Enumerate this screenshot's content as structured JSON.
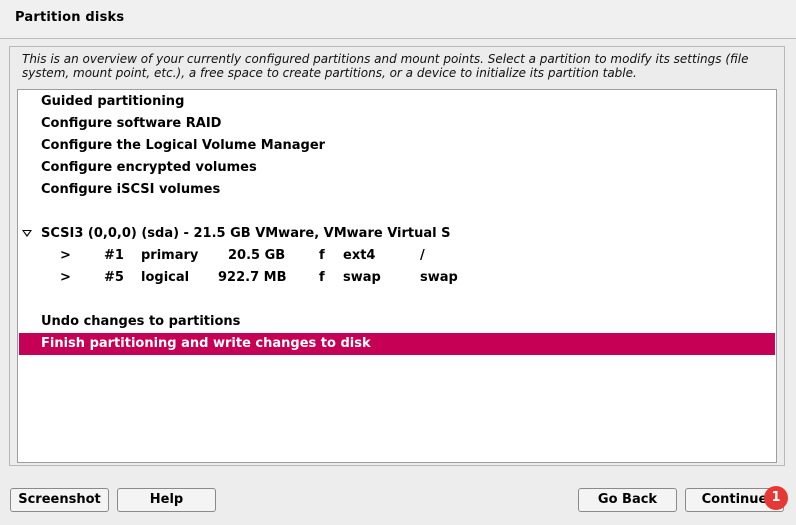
{
  "window": {
    "title": "Partition disks"
  },
  "description": "This is an overview of your currently configured partitions and mount points. Select a partition to modify its settings (file system, mount point, etc.), a free space to create partitions, or a device to initialize its partition table.",
  "menu": {
    "guided": "Guided partitioning",
    "software_raid": "Configure software RAID",
    "lvm": "Configure the Logical Volume Manager",
    "encrypted": "Configure encrypted volumes",
    "iscsi": "Configure iSCSI volumes"
  },
  "disk": {
    "label": "SCSI3 (0,0,0) (sda) - 21.5 GB VMware, VMware Virtual S",
    "partitions": [
      {
        "arrow": ">",
        "number": "#1",
        "type": "primary",
        "size": "20.5 GB",
        "flag": "f",
        "fs": "ext4",
        "mount": "/"
      },
      {
        "arrow": ">",
        "number": "#5",
        "type": "logical",
        "size": "922.7 MB",
        "flag": "f",
        "fs": "swap",
        "mount": "swap"
      }
    ]
  },
  "actions": {
    "undo": "Undo changes to partitions",
    "finish": "Finish partitioning and write changes to disk"
  },
  "buttons": {
    "screenshot": "Screenshot",
    "help": "Help",
    "go_back": "Go Back",
    "continue": "Continue"
  },
  "badge": {
    "count": "1"
  },
  "colors": {
    "selection": "#c60055",
    "badge": "#e53935"
  }
}
